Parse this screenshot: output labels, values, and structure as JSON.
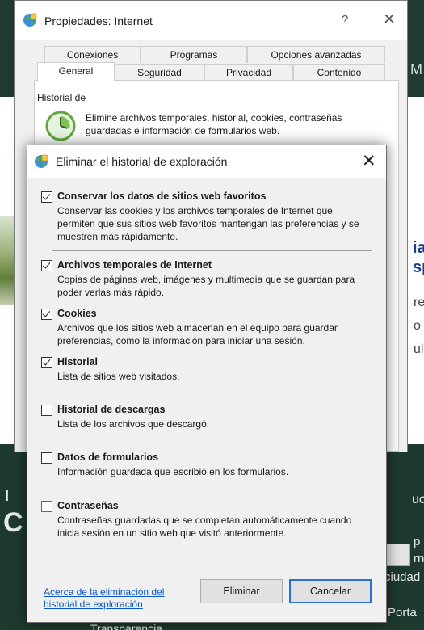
{
  "background": {
    "side_m": "M",
    "side_ia": "ia",
    "side_sp": "sp",
    "side_re": "re",
    "side_o": "o",
    "side_ul": "ul",
    "dark_i": "I",
    "dark_c": "C",
    "dark_uc": "uc",
    "dark_p": "p",
    "dark_rn": "rn",
    "dark_ciudad": "ciudad",
    "dark_porta": "Porta",
    "dark_transp": "Transparencia"
  },
  "properties_window": {
    "title": "Propiedades: Internet",
    "help_glyph": "?",
    "close_glyph": "✕",
    "tabs_back": [
      "Conexiones",
      "Programas",
      "Opciones avanzadas"
    ],
    "tabs_front": [
      "General",
      "Seguridad",
      "Privacidad",
      "Contenido"
    ],
    "active_tab": "General",
    "history_section_label": "Historial de",
    "history_description": "Elimine archivos temporales, historial, cookies, contraseñas guardadas e información de formularios web."
  },
  "dialog": {
    "title": "Eliminar el historial de exploración",
    "close_glyph": "✕",
    "options": [
      {
        "title": "Conservar los datos de sitios web favoritos",
        "checked": true,
        "description": "Conservar las cookies y los archivos temporales de Internet que permiten que sus sitios web favoritos mantengan las preferencias y se muestren más rápidamente."
      },
      {
        "title": "Archivos temporales de Internet",
        "checked": true,
        "description": "Copias de páginas web, imágenes y multimedia que se guardan para poder verlas más rápido."
      },
      {
        "title": "Cookies",
        "checked": true,
        "description": "Archivos que los sitios web almacenan en el equipo para guardar preferencias, como la información para iniciar una sesión."
      },
      {
        "title": "Historial",
        "checked": true,
        "description": "Lista de sitios web visitados."
      },
      {
        "title": "Historial de descargas",
        "checked": false,
        "description": "Lista de los archivos que descargó."
      },
      {
        "title": "Datos de formularios",
        "checked": false,
        "description": "Información guardada que escribió en los formularios."
      },
      {
        "title": "Contraseñas",
        "checked": false,
        "description": "Contraseñas guardadas que se completan automáticamente cuando inicia sesión en un sitio web que visitó anteriormente."
      }
    ],
    "link": "Acerca de la eliminación del historial de exploración",
    "delete_button": "Eliminar",
    "cancel_button": "Cancelar"
  },
  "colors": {
    "link": "#0a56c6",
    "focus_border": "#2a6fd6",
    "page_dark_green": "#1e3a2e"
  }
}
